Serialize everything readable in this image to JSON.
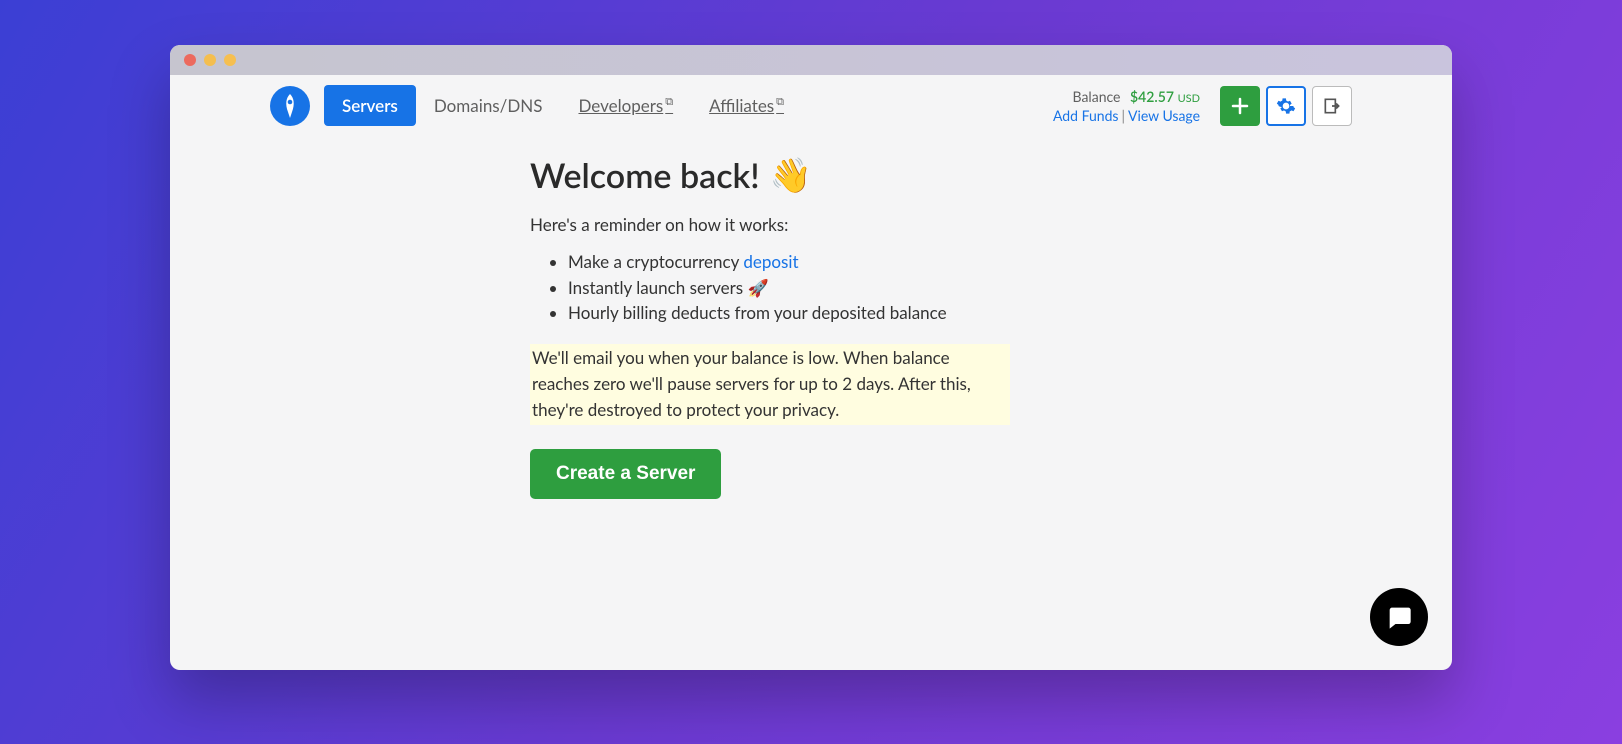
{
  "nav": {
    "servers": "Servers",
    "domains": "Domains/DNS",
    "developers": "Developers",
    "affiliates": "Affiliates"
  },
  "balance": {
    "label": "Balance",
    "amount": "$42.57",
    "currency": "USD",
    "add_funds": "Add Funds",
    "view_usage": "View Usage"
  },
  "welcome": {
    "title": "Welcome back!",
    "intro": "Here's a reminder on how it works:",
    "bullet1a": "Make a cryptocurrency ",
    "bullet1link": "deposit",
    "bullet2": "Instantly launch servers 🚀",
    "bullet3": "Hourly billing deducts from your deposited balance",
    "highlight": " We'll email you when your balance is low. When balance reaches zero we'll pause servers for up to 2 days. After this, they're destroyed to protect your privacy.",
    "cta": "Create a Server"
  }
}
